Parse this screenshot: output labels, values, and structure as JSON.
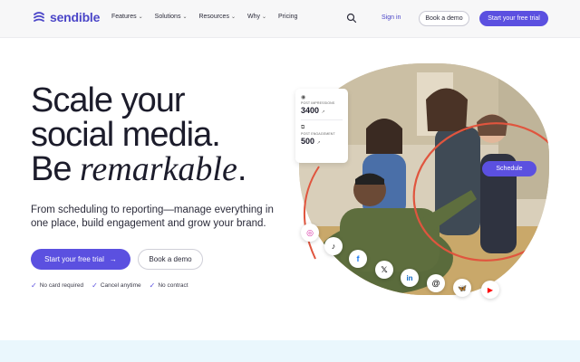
{
  "brand": {
    "name": "sendible",
    "accent": "#5b50e0",
    "logo_color": "#4b46c8"
  },
  "nav": {
    "links": [
      {
        "label": "Features",
        "has_menu": true
      },
      {
        "label": "Solutions",
        "has_menu": true
      },
      {
        "label": "Resources",
        "has_menu": true
      },
      {
        "label": "Why",
        "has_menu": true
      },
      {
        "label": "Pricing",
        "has_menu": false
      }
    ],
    "search_icon": "search-icon",
    "signin": "Sign in",
    "demo": "Book a demo",
    "trial": "Start your free trial"
  },
  "hero": {
    "line1": "Scale your",
    "line2": "social media.",
    "line3_prefix": "Be ",
    "line3_em": "remarkable",
    "line3_suffix": ".",
    "subtext": "From scheduling to reporting—manage everything in one place, build engagement and grow your brand.",
    "cta_trial": "Start your free trial",
    "cta_trial_icon": "arrow-right-icon",
    "cta_demo": "Book a demo",
    "checks": [
      "No card required",
      "Cancel anytime",
      "No contract"
    ]
  },
  "stats": [
    {
      "icon": "eye-icon",
      "label": "Post impressions",
      "value": "3400",
      "trend": "↗"
    },
    {
      "icon": "copy-icon",
      "label": "Post engagement",
      "value": "500",
      "trend": "↗"
    }
  ],
  "schedule_label": "Schedule",
  "socials": [
    {
      "name": "instagram-icon",
      "glyph": "◎",
      "color": "#d6249f"
    },
    {
      "name": "tiktok-icon",
      "glyph": "♪",
      "color": "#111111"
    },
    {
      "name": "facebook-icon",
      "glyph": "f",
      "color": "#1877f2"
    },
    {
      "name": "x-icon",
      "glyph": "𝕏",
      "color": "#111111"
    },
    {
      "name": "linkedin-icon",
      "glyph": "in",
      "color": "#0a66c2"
    },
    {
      "name": "threads-icon",
      "glyph": "@",
      "color": "#111111"
    },
    {
      "name": "bluesky-icon",
      "glyph": "🦋",
      "color": "#1185fe"
    },
    {
      "name": "youtube-icon",
      "glyph": "▶",
      "color": "#ff0000"
    }
  ]
}
